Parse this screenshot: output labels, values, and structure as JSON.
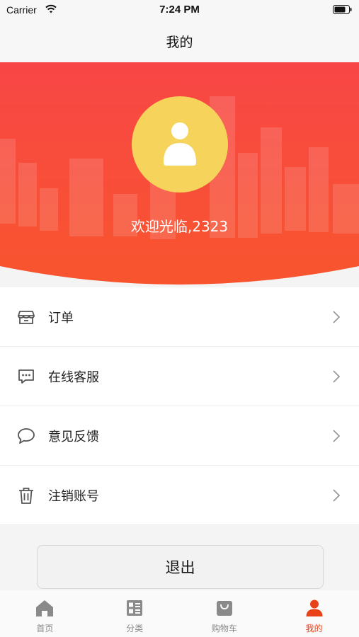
{
  "status_bar": {
    "carrier": "Carrier",
    "time": "7:24 PM",
    "icons": [
      "wifi-icon",
      "battery-icon"
    ]
  },
  "nav": {
    "title": "我的"
  },
  "profile": {
    "welcome_text": "欢迎光临,2323",
    "avatar_icon": "user-icon",
    "header_gradient": [
      "#f84646",
      "#f8552e"
    ],
    "avatar_color": "#f6d35a"
  },
  "menu": {
    "items": [
      {
        "label": "订单",
        "icon": "store-icon"
      },
      {
        "label": "在线客服",
        "icon": "chat-dots-icon"
      },
      {
        "label": "意见反馈",
        "icon": "speech-bubble-icon"
      },
      {
        "label": "注销账号",
        "icon": "trash-icon"
      }
    ]
  },
  "logout": {
    "label": "退出"
  },
  "tab_bar": {
    "active_color": "#e8421b",
    "inactive_color": "#8a8a8a",
    "tabs": [
      {
        "label": "首页",
        "icon": "home-icon",
        "active": false
      },
      {
        "label": "分类",
        "icon": "category-icon",
        "active": false
      },
      {
        "label": "购物车",
        "icon": "cart-icon",
        "active": false
      },
      {
        "label": "我的",
        "icon": "profile-icon",
        "active": true
      }
    ]
  }
}
